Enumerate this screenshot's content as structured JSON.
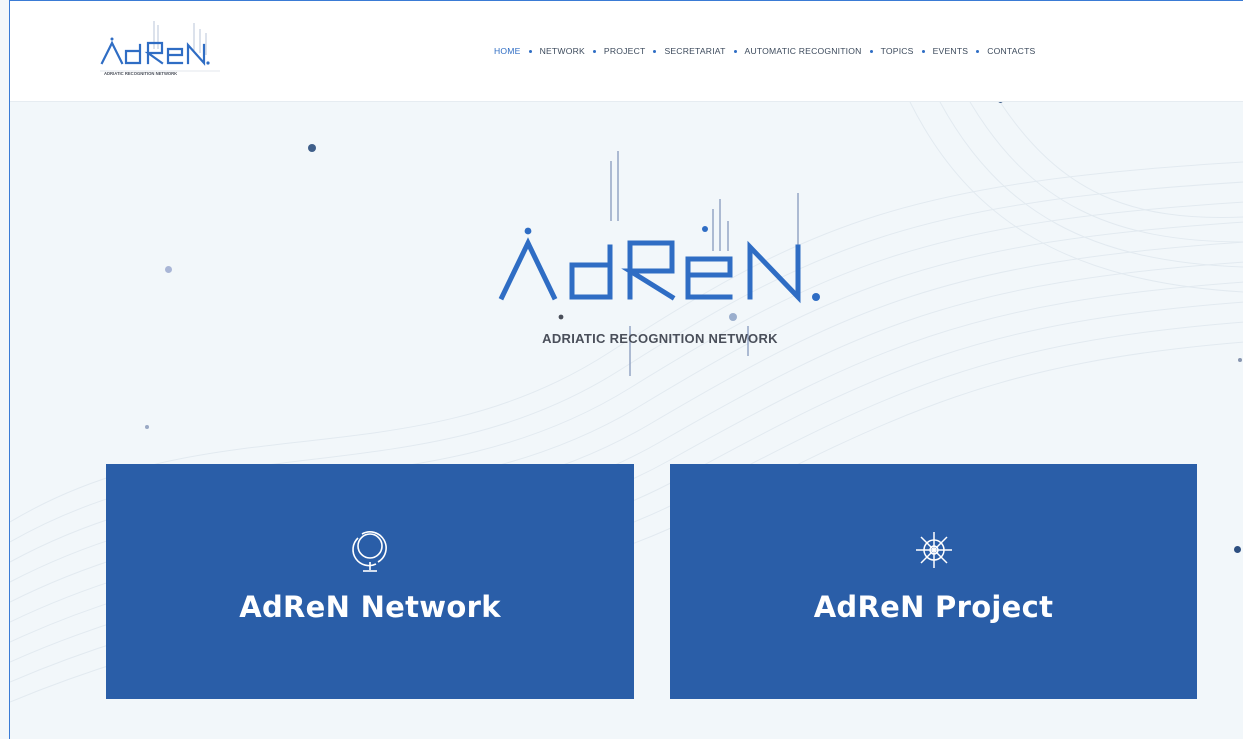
{
  "brand": {
    "logo_text": "AdReN",
    "tagline": "ADRIATIC RECOGNITION NETWORK",
    "logo_color": "#2f6dc4",
    "tagline_color": "#4a4f5a"
  },
  "nav": {
    "items": [
      {
        "label": "HOME",
        "active": true
      },
      {
        "label": "NETWORK",
        "active": false
      },
      {
        "label": "PROJECT",
        "active": false
      },
      {
        "label": "SECRETARIAT",
        "active": false
      },
      {
        "label": "AUTOMATIC RECOGNITION",
        "active": false
      },
      {
        "label": "TOPICS",
        "active": false
      },
      {
        "label": "EVENTS",
        "active": false
      },
      {
        "label": "CONTACTS",
        "active": false
      }
    ]
  },
  "cards": [
    {
      "title": "AdReN Network",
      "icon": "globe-icon"
    },
    {
      "title": "AdReN Project",
      "icon": "helm-wheel-icon"
    }
  ],
  "colors": {
    "accent": "#2f6dc4",
    "card_bg": "#2a5ea8",
    "page_bg": "#f2f7fa"
  }
}
